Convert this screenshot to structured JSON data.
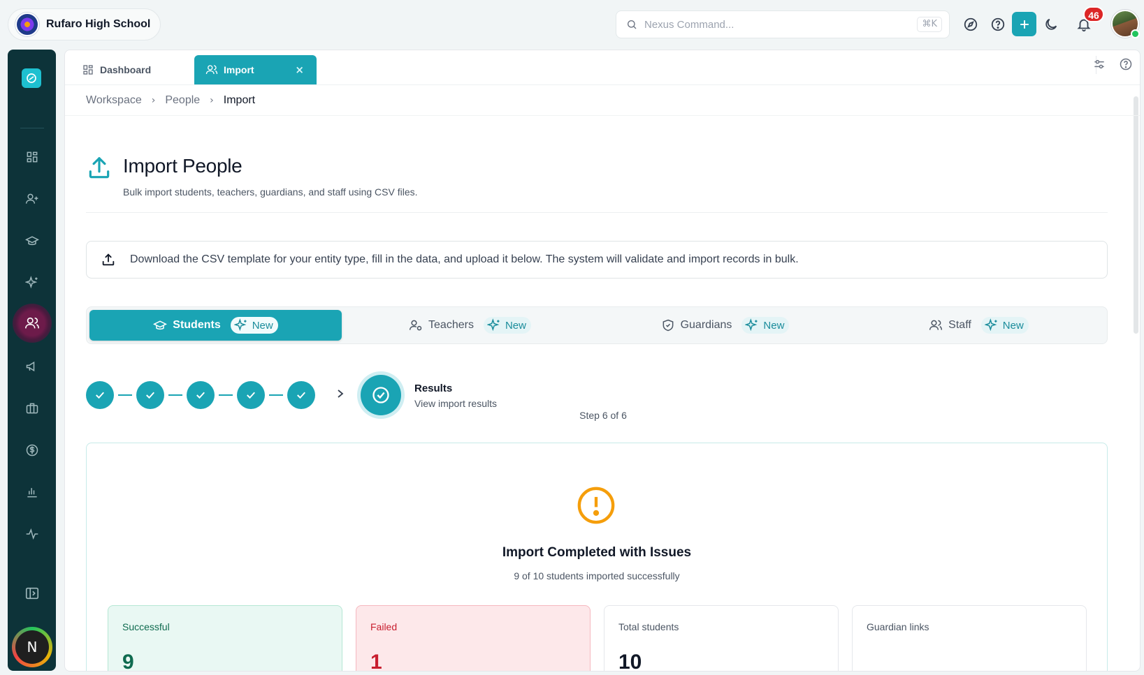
{
  "app": {
    "school_name": "Rufaro High School",
    "search_placeholder": "Nexus Command...",
    "search_shortcut": "⌘K",
    "notification_count": "46",
    "accent_color": "#1aa4b4",
    "sidebar_user_initial": "N"
  },
  "tabs": {
    "dashboard": "Dashboard",
    "import": "Import",
    "close_glyph": "×"
  },
  "breadcrumb": [
    "Workspace",
    "People",
    "Import"
  ],
  "page": {
    "title": "Import People",
    "subtitle": "Bulk import students, teachers, guardians, and staff using CSV files."
  },
  "info": {
    "text": "Download the CSV template for your entity type, fill in the data, and upload it below. The system will validate and import records in bulk."
  },
  "entity_tabs": [
    {
      "label": "Students",
      "badge": "New",
      "active": true,
      "icon": "graduation-cap-icon"
    },
    {
      "label": "Teachers",
      "badge": "New",
      "active": false,
      "icon": "user-cog-icon"
    },
    {
      "label": "Guardians",
      "badge": "New",
      "active": false,
      "icon": "shield-icon"
    },
    {
      "label": "Staff",
      "badge": "New",
      "active": false,
      "icon": "users-icon"
    }
  ],
  "stepper": {
    "completed_steps": 5,
    "current_label": "Results",
    "current_desc": "View import results",
    "count_text": "Step 6 of 6"
  },
  "results": {
    "title": "Import Completed with Issues",
    "subtitle": "9 of 10 students imported successfully",
    "stats": [
      {
        "label": "Successful",
        "value": "9"
      },
      {
        "label": "Failed",
        "value": "1"
      },
      {
        "label": "Total students",
        "value": "10"
      },
      {
        "label": "Guardian links",
        "value": ""
      }
    ]
  },
  "sidebar_icons": [
    "grid-icon",
    "user-plus-icon",
    "graduation-cap-icon",
    "sparkles-icon",
    "users-icon",
    "megaphone-icon",
    "briefcase-icon",
    "dollar-icon",
    "bar-chart-icon",
    "activity-icon",
    "panel-toggle-icon"
  ]
}
